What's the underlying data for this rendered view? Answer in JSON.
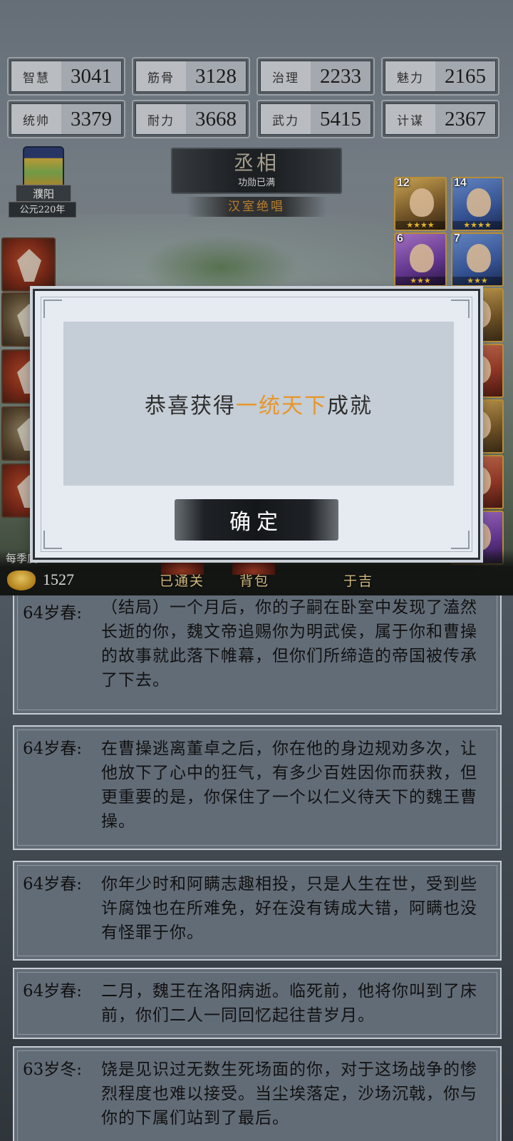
{
  "stats": [
    {
      "label": "智慧",
      "value": "3041"
    },
    {
      "label": "筋骨",
      "value": "3128"
    },
    {
      "label": "治理",
      "value": "2233"
    },
    {
      "label": "魅力",
      "value": "2165"
    },
    {
      "label": "统帅",
      "value": "3379"
    },
    {
      "label": "耐力",
      "value": "3668"
    },
    {
      "label": "武力",
      "value": "5415"
    },
    {
      "label": "计谋",
      "value": "2367"
    }
  ],
  "city": {
    "name": "濮阳",
    "year": "公元220年"
  },
  "title_plaque": {
    "rank": "丞相",
    "sub": "功勋已满",
    "ending": "汉室绝唱"
  },
  "heroes": [
    {
      "level": "12",
      "stars": "★★★★"
    },
    {
      "level": "14",
      "stars": "★★★★"
    },
    {
      "level": "6",
      "stars": "★★★"
    },
    {
      "level": "7",
      "stars": "★★★"
    }
  ],
  "status": {
    "season_text": "每季度: ",
    "coins": "1527"
  },
  "nav": {
    "cleared": "已通关",
    "backpack": "背包",
    "fortune": "于吉"
  },
  "modal": {
    "msg_prefix": "恭喜获得",
    "msg_highlight": "一统天下",
    "msg_suffix": "成就",
    "ok_label": "确定"
  },
  "colors": {
    "highlight": "#e8962a",
    "rank_text": "#b4ab97",
    "ending_text": "#c98a32"
  },
  "logs": [
    {
      "age": "64岁春:",
      "text": "（结局）一个月后，你的子嗣在卧室中发现了溘然长逝的你，魏文帝追赐你为明武侯，属于你和曹操的故事就此落下帷幕，但你们所缔造的帝国被传承了下去。"
    },
    {
      "age": "64岁春:",
      "text": "在曹操逃离董卓之后，你在他的身边规劝多次，让他放下了心中的狂气，有多少百姓因你而获救，但更重要的是，你保住了一个以仁义待天下的魏王曹操。"
    },
    {
      "age": "64岁春:",
      "text": "你年少时和阿瞒志趣相投，只是人生在世，受到些许腐蚀也在所难免，好在没有铸成大错，阿瞒也没有怪罪于你。"
    },
    {
      "age": "64岁春:",
      "text": "二月，魏王在洛阳病逝。临死前，他将你叫到了床前，你们二人一同回忆起往昔岁月。"
    },
    {
      "age": "63岁冬:",
      "text": "饶是见识过无数生死场面的你，对于这场战争的惨烈程度也难以接受。当尘埃落定，沙场沉戟，你与你的下属们站到了最后。"
    }
  ]
}
